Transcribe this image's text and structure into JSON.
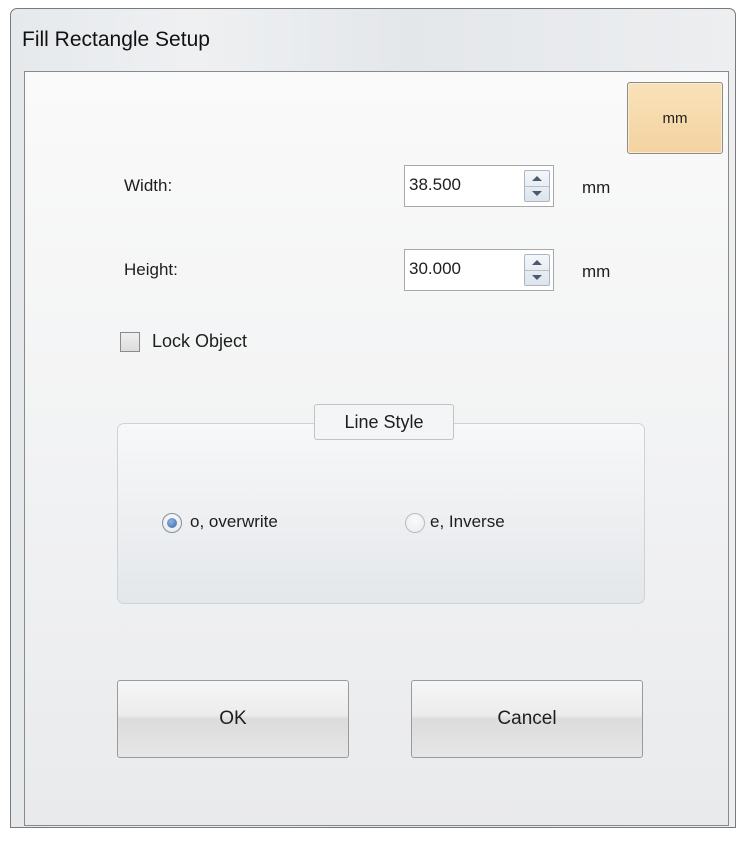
{
  "window": {
    "title": "Fill Rectangle Setup"
  },
  "unit_button": {
    "label": "mm"
  },
  "width": {
    "label": "Width:",
    "value": "38.500",
    "unit": "mm"
  },
  "height": {
    "label": "Height:",
    "value": "30.000",
    "unit": "mm"
  },
  "lock_object": {
    "label": "Lock Object",
    "checked": false
  },
  "line_style": {
    "legend": "Line Style",
    "options": [
      {
        "label": "o, overwrite",
        "selected": true
      },
      {
        "label": "e, Inverse",
        "selected": false
      }
    ]
  },
  "buttons": {
    "ok_label": "OK",
    "cancel_label": "Cancel"
  },
  "icons": {
    "spin_up": "triangle-up-icon",
    "spin_down": "triangle-down-icon"
  },
  "colors": {
    "unit_button_bg": "#f3d3a0",
    "radio_selected": "#3a66a8"
  }
}
